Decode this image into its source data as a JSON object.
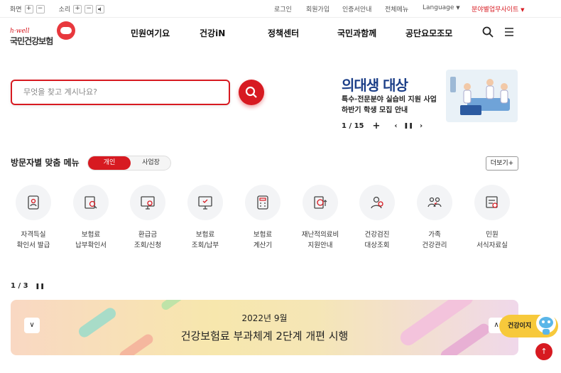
{
  "utility": {
    "screen_label": "화면",
    "sound_label": "소리",
    "plus": "+",
    "minus": "−",
    "links": [
      "로그인",
      "회원가입",
      "인증서안내",
      "전체메뉴",
      "Language"
    ],
    "site_link": "분야별업무사이트",
    "red": "#d71a21"
  },
  "logo": {
    "tagline": "h·well",
    "name": "국민건강보험"
  },
  "nav": [
    "민원여기요",
    "건강iN",
    "정책센터",
    "국민과함께",
    "공단요모조모"
  ],
  "search": {
    "placeholder": "무엇을 찾고 계시나요?"
  },
  "banner": {
    "title": "의대생 대상",
    "line1": "특수·전문분야 실습비 지원 사업",
    "line2": "하반기 학생 모집 안내",
    "pager": "1 / 15"
  },
  "menu_section": {
    "title": "방문자별 맞춤 메뉴",
    "tab_on": "개인",
    "tab_off": "사업장",
    "more": "더보기+",
    "items": [
      {
        "label": "자격득실\n확인서 발급",
        "icon": "id-card-icon"
      },
      {
        "label": "보험료\n납부확인서",
        "icon": "document-search-icon"
      },
      {
        "label": "환급금\n조회/신청",
        "icon": "monitor-refund-icon"
      },
      {
        "label": "보험료\n조회/납부",
        "icon": "monitor-pay-icon"
      },
      {
        "label": "보험료\n계산기",
        "icon": "calculator-icon"
      },
      {
        "label": "재난적의료비\n지원안내",
        "icon": "won-support-icon"
      },
      {
        "label": "건강검진\n대상조회",
        "icon": "person-check-icon"
      },
      {
        "label": "가족\n건강관리",
        "icon": "family-icon"
      },
      {
        "label": "민원\n서식자료실",
        "icon": "form-download-icon"
      }
    ]
  },
  "slider": {
    "pager": "1 / 3"
  },
  "bottom_banner": {
    "sub": "2022년 9월",
    "main": "건강보험료 부과체계 2단계 개편 시행"
  },
  "chat": {
    "label": "건강이지"
  }
}
